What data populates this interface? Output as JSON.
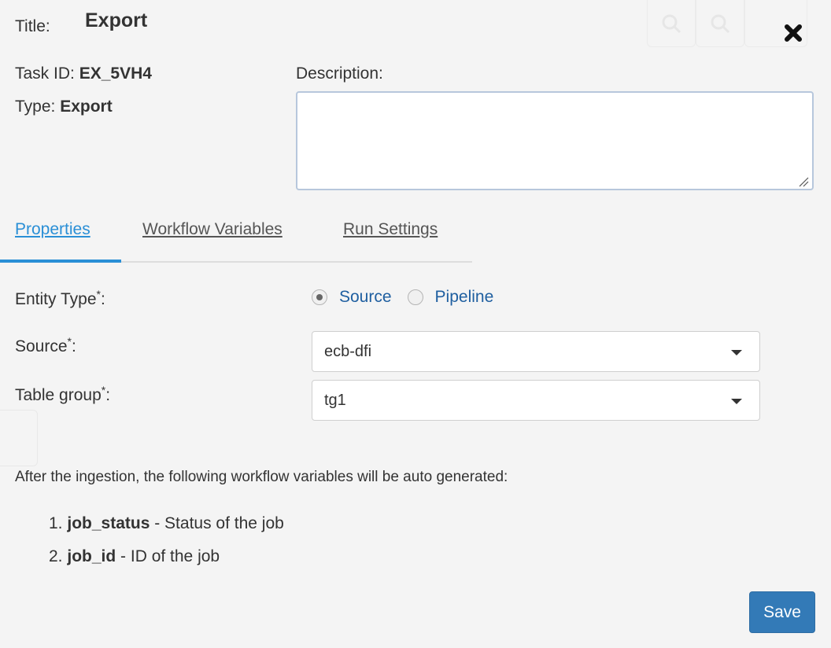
{
  "dialog": {
    "title_label": "Title:",
    "title_value": "Export",
    "task_id_label": "Task ID:",
    "task_id_value": "EX_5VH4",
    "type_label": "Type:",
    "type_value": "Export",
    "description_label": "Description:",
    "description_value": ""
  },
  "tabs": [
    {
      "label": "Properties",
      "active": true
    },
    {
      "label": "Workflow Variables",
      "active": false
    },
    {
      "label": "Run Settings",
      "active": false
    }
  ],
  "form": {
    "entity_type_label": "Entity Type",
    "entity_type_options": [
      "Source",
      "Pipeline"
    ],
    "entity_type_selected": "Source",
    "source_label": "Source",
    "source_value": "ecb-dfi",
    "table_group_label": "Table group",
    "table_group_value": "tg1",
    "required_marker": "*",
    "colon": ":"
  },
  "info": {
    "intro": "After the ingestion, the following workflow variables will be auto generated:",
    "variables": [
      {
        "num": "1.",
        "name": "job_status",
        "desc": " - Status of the job"
      },
      {
        "num": "2.",
        "name": "job_id",
        "desc": " - ID of the job"
      }
    ]
  },
  "actions": {
    "save_label": "Save"
  },
  "colors": {
    "accent": "#2a8fd6",
    "primary_button": "#337ab7",
    "radio_text": "#1f5fa0"
  }
}
